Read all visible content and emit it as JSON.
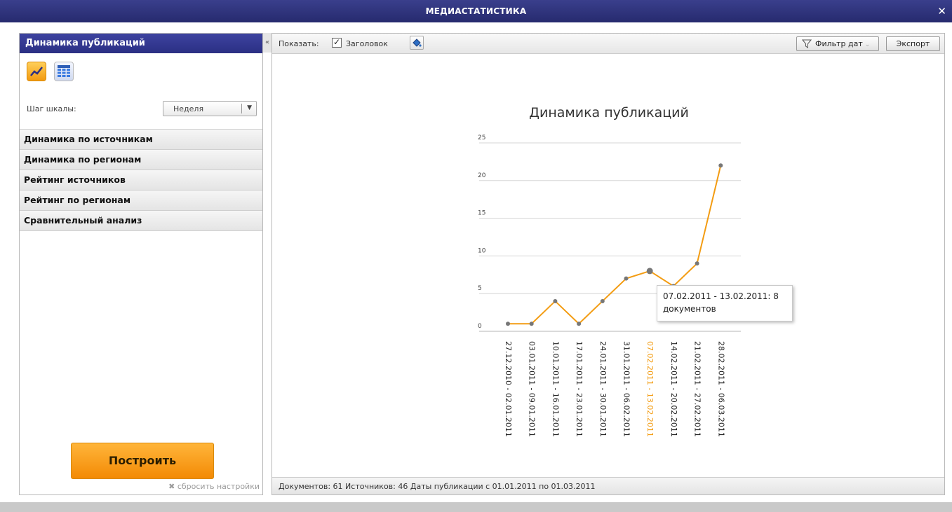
{
  "window": {
    "title": "МЕДИАСТАТИСТИКА",
    "close_glyph": "✕"
  },
  "sidebar": {
    "header": "Динамика публикаций",
    "view_icons": [
      "line-chart-icon",
      "table-grid-icon"
    ],
    "scale_label": "Шаг шкалы:",
    "scale_value": "Неделя",
    "items": [
      {
        "label": "Динамика по источникам"
      },
      {
        "label": "Динамика по регионам"
      },
      {
        "label": "Рейтинг источников"
      },
      {
        "label": "Рейтинг по регионам"
      },
      {
        "label": "Сравнительный анализ"
      }
    ],
    "build_label": "Построить",
    "reset_label": "✖ сбросить настройки"
  },
  "toolbar": {
    "show_label": "Показать:",
    "header_checkbox_label": "Заголовок",
    "header_checked": true,
    "filter_label": "Фильтр дат",
    "export_label": "Экспорт"
  },
  "chart_data": {
    "type": "line",
    "title": "Динамика публикаций",
    "x": [
      "27.12.2010 - 02.01.2011",
      "03.01.2011 - 09.01.2011",
      "10.01.2011 - 16.01.2011",
      "17.01.2011 - 23.01.2011",
      "24.01.2011 - 30.01.2011",
      "31.01.2011 - 06.02.2011",
      "07.02.2011 - 13.02.2011",
      "14.02.2011 - 20.02.2011",
      "21.02.2011 - 27.02.2011",
      "28.02.2011 - 06.03.2011"
    ],
    "series": [
      {
        "values": [
          1,
          1,
          4,
          1,
          4,
          7,
          8,
          6,
          9,
          22
        ]
      }
    ],
    "ylim": [
      0,
      25
    ],
    "yticks": [
      0,
      5,
      10,
      15,
      20,
      25
    ],
    "grid": true,
    "highlight_index": 6,
    "line_color": "#f39c12",
    "point_color": "#777777"
  },
  "tooltip": {
    "line1": "07.02.2011 - 13.02.2011: 8",
    "line2": "документов"
  },
  "status": {
    "text": "Документов: 61  Источников: 46  Даты публикации с 01.01.2011 по 01.03.2011"
  }
}
